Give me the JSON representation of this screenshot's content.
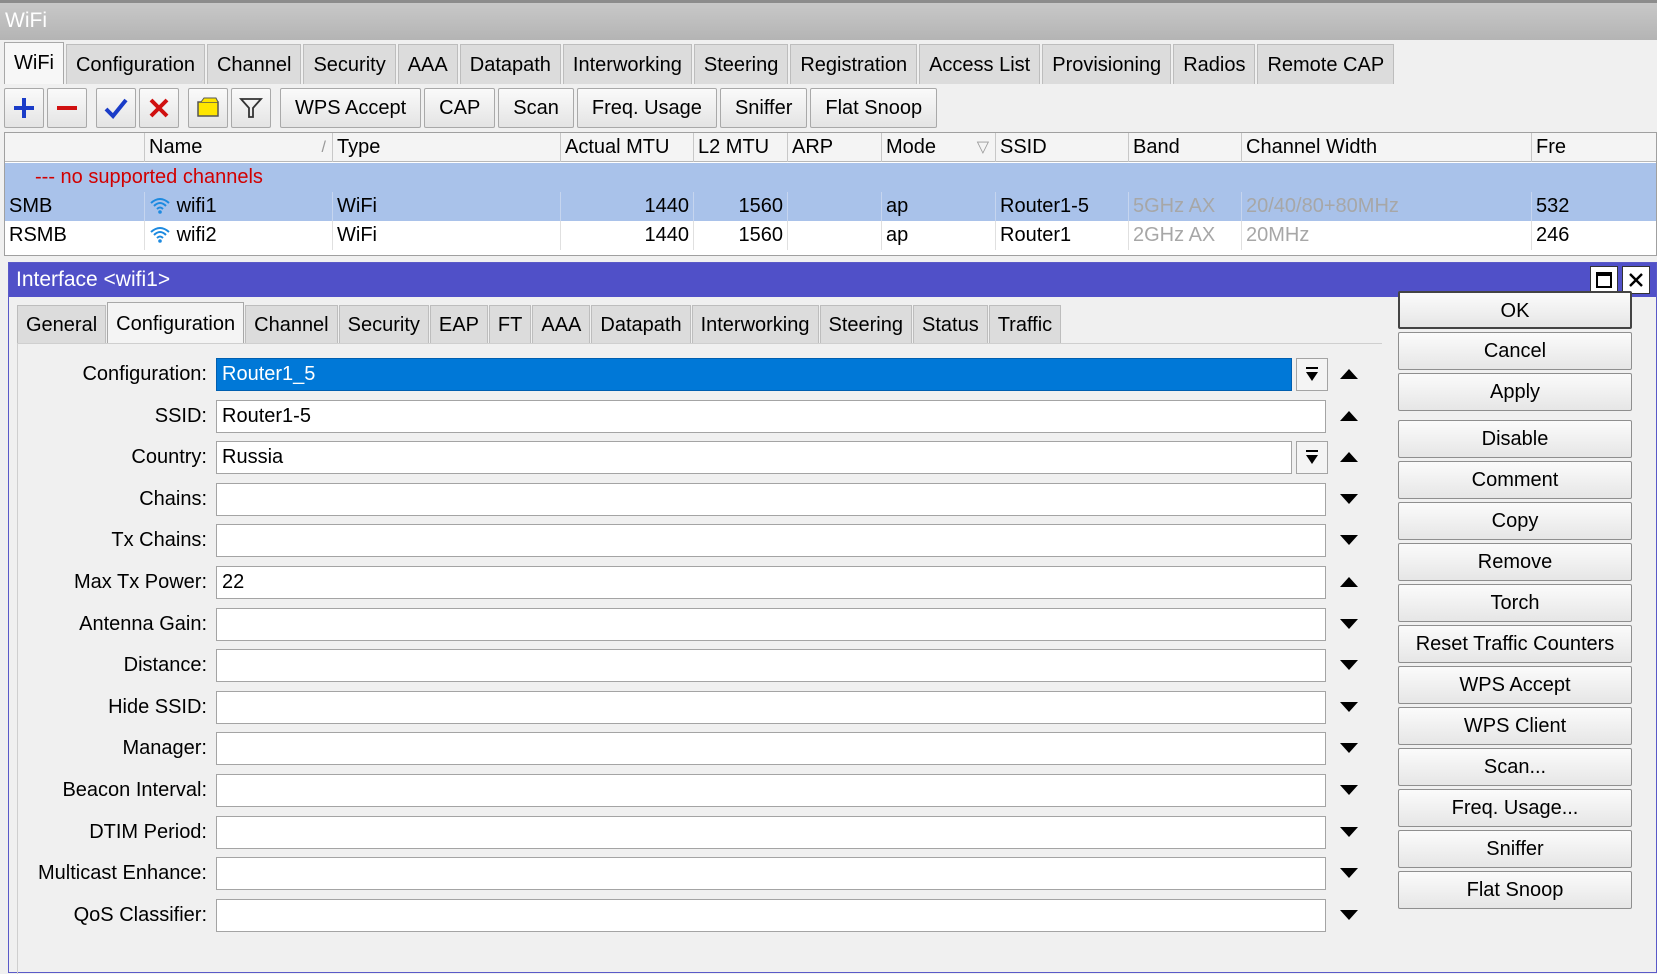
{
  "window": {
    "title": "WiFi"
  },
  "main_tabs": [
    {
      "label": "WiFi"
    },
    {
      "label": "Configuration"
    },
    {
      "label": "Channel"
    },
    {
      "label": "Security"
    },
    {
      "label": "AAA"
    },
    {
      "label": "Datapath"
    },
    {
      "label": "Interworking"
    },
    {
      "label": "Steering"
    },
    {
      "label": "Registration"
    },
    {
      "label": "Access List"
    },
    {
      "label": "Provisioning"
    },
    {
      "label": "Radios"
    },
    {
      "label": "Remote CAP"
    }
  ],
  "toolbar": {
    "icons": [
      "add-icon",
      "remove-icon",
      "enable-check-icon",
      "disable-x-icon",
      "comment-note-icon",
      "filter-icon"
    ],
    "wps_accept": "WPS Accept",
    "cap": "CAP",
    "scan": "Scan",
    "freq_usage": "Freq. Usage",
    "sniffer": "Sniffer",
    "flat_snoop": "Flat Snoop"
  },
  "table": {
    "columns": [
      "",
      "Name",
      "Type",
      "Actual MTU",
      "L2 MTU",
      "ARP",
      "Mode",
      "SSID",
      "Band",
      "Channel Width",
      "Fre"
    ],
    "comment": "--- no supported channels",
    "rows": [
      {
        "flags": "SMB",
        "name": "wifi1",
        "type": "WiFi",
        "actual_mtu": "1440",
        "l2_mtu": "1560",
        "arp": "",
        "mode": "ap",
        "ssid": "Router1-5",
        "band": "5GHz AX",
        "channel_width": "20/40/80+80MHz",
        "freq": "532"
      },
      {
        "flags": "RSMB",
        "name": "wifi2",
        "type": "WiFi",
        "actual_mtu": "1440",
        "l2_mtu": "1560",
        "arp": "",
        "mode": "ap",
        "ssid": "Router1",
        "band": "2GHz AX",
        "channel_width": "20MHz",
        "freq": "246"
      }
    ]
  },
  "dialog": {
    "title": "Interface <wifi1>",
    "tabs": [
      {
        "label": "General"
      },
      {
        "label": "Configuration"
      },
      {
        "label": "Channel"
      },
      {
        "label": "Security"
      },
      {
        "label": "EAP"
      },
      {
        "label": "FT"
      },
      {
        "label": "AAA"
      },
      {
        "label": "Datapath"
      },
      {
        "label": "Interworking"
      },
      {
        "label": "Steering"
      },
      {
        "label": "Status"
      },
      {
        "label": "Traffic"
      }
    ],
    "active_tab": "Configuration",
    "fields": [
      {
        "label": "Configuration:",
        "value": "Router1_5",
        "dropdown": true,
        "arrow": "up",
        "selected": true
      },
      {
        "label": "SSID:",
        "value": "Router1-5",
        "dropdown": false,
        "arrow": "up"
      },
      {
        "label": "Country:",
        "value": "Russia",
        "dropdown": true,
        "arrow": "up"
      },
      {
        "label": "Chains:",
        "value": "",
        "dropdown": false,
        "arrow": "down"
      },
      {
        "label": "Tx Chains:",
        "value": "",
        "dropdown": false,
        "arrow": "down"
      },
      {
        "label": "Max Tx Power:",
        "value": "22",
        "dropdown": false,
        "arrow": "up"
      },
      {
        "label": "Antenna Gain:",
        "value": "",
        "dropdown": false,
        "arrow": "down"
      },
      {
        "label": "Distance:",
        "value": "",
        "dropdown": false,
        "arrow": "down"
      },
      {
        "label": "Hide SSID:",
        "value": "",
        "dropdown": false,
        "arrow": "down"
      },
      {
        "label": "Manager:",
        "value": "",
        "dropdown": false,
        "arrow": "down"
      },
      {
        "label": "Beacon Interval:",
        "value": "",
        "dropdown": false,
        "arrow": "down"
      },
      {
        "label": "DTIM Period:",
        "value": "",
        "dropdown": false,
        "arrow": "down"
      },
      {
        "label": "Multicast Enhance:",
        "value": "",
        "dropdown": false,
        "arrow": "down"
      },
      {
        "label": "QoS Classifier:",
        "value": "",
        "dropdown": false,
        "arrow": "down"
      }
    ],
    "buttons": [
      {
        "label": "OK"
      },
      {
        "label": "Cancel"
      },
      {
        "label": "Apply"
      },
      {
        "label": "Disable"
      },
      {
        "label": "Comment"
      },
      {
        "label": "Copy"
      },
      {
        "label": "Remove"
      },
      {
        "label": "Torch"
      },
      {
        "label": "Reset Traffic Counters"
      },
      {
        "label": "WPS Accept"
      },
      {
        "label": "WPS Client"
      },
      {
        "label": "Scan..."
      },
      {
        "label": "Freq. Usage..."
      },
      {
        "label": "Sniffer"
      },
      {
        "label": "Flat Snoop"
      }
    ]
  },
  "colors": {
    "selection": "#0078d7",
    "row_highlight": "#a9c2ea",
    "dialog_title": "#5050c8",
    "comment_text": "#d10000"
  }
}
